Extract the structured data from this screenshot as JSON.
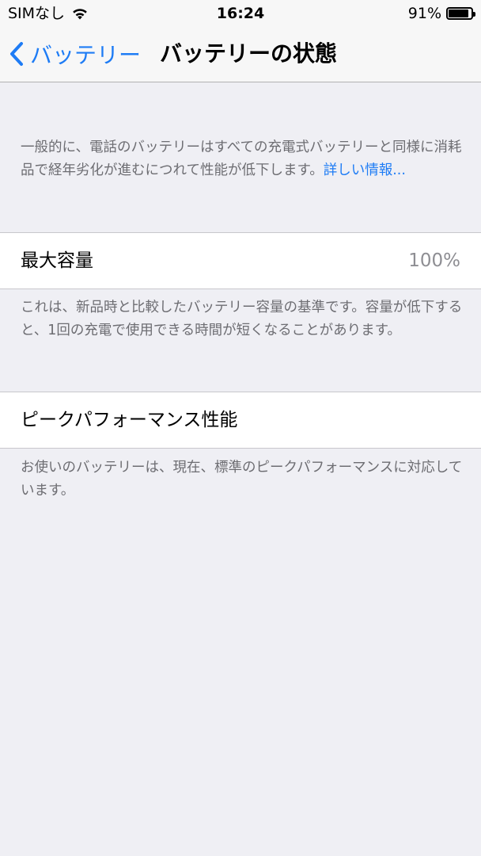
{
  "status_bar": {
    "carrier": "SIMなし",
    "time": "16:24",
    "battery_percent": "91%",
    "battery_level": 0.91,
    "wifi_icon": "wifi-icon",
    "battery_icon": "battery-icon"
  },
  "nav": {
    "back_label": "バッテリー",
    "back_icon": "chevron-left-icon",
    "title": "バッテリーの状態"
  },
  "intro": {
    "text": "一般的に、電話のバッテリーはすべての充電式バッテリーと同様に消耗品で経年劣化が進むにつれて性能が低下します。",
    "link": "詳しい情報..."
  },
  "max_capacity": {
    "label": "最大容量",
    "value": "100%",
    "description": "これは、新品時と比較したバッテリー容量の基準です。容量が低下すると、1回の充電で使用できる時間が短くなることがあります。"
  },
  "peak_performance": {
    "label": "ピークパフォーマンス性能",
    "description": "お使いのバッテリーは、現在、標準のピークパフォーマンスに対応しています。"
  },
  "colors": {
    "accent": "#1e7cf5",
    "background": "#efeff4",
    "secondary_text": "#6d6d72"
  }
}
